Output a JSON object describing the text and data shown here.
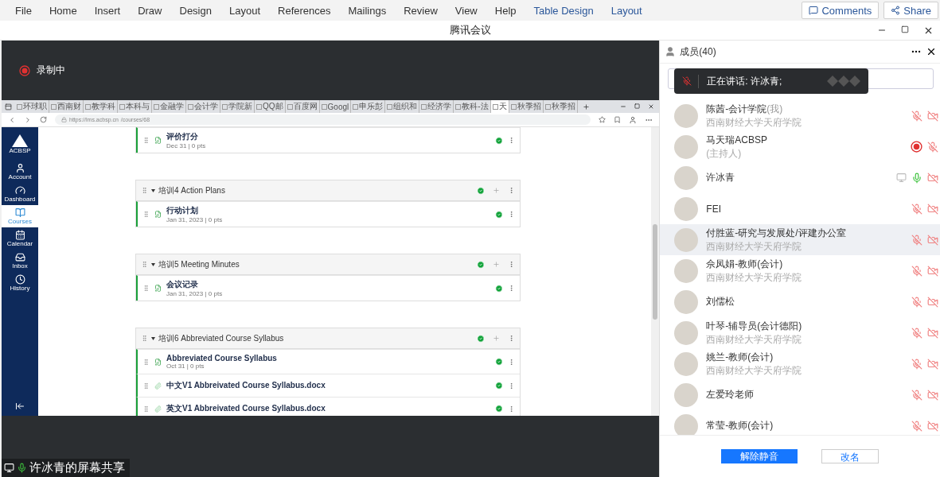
{
  "ribbon": {
    "menu": [
      {
        "label": "File",
        "kind": "standard"
      },
      {
        "label": "Home",
        "kind": "standard"
      },
      {
        "label": "Insert",
        "kind": "standard"
      },
      {
        "label": "Draw",
        "kind": "standard"
      },
      {
        "label": "Design",
        "kind": "standard"
      },
      {
        "label": "Layout",
        "kind": "standard"
      },
      {
        "label": "References",
        "kind": "standard"
      },
      {
        "label": "Mailings",
        "kind": "standard"
      },
      {
        "label": "Review",
        "kind": "standard"
      },
      {
        "label": "View",
        "kind": "standard"
      },
      {
        "label": "Help",
        "kind": "standard"
      },
      {
        "label": "Table Design",
        "kind": "contextual"
      },
      {
        "label": "Layout",
        "kind": "contextual"
      }
    ],
    "comments_button": "Comments",
    "share_button": "Share"
  },
  "window": {
    "title": "腾讯会议"
  },
  "stage": {
    "recording_label": "录制中",
    "caption": "许冰青的屏幕共享"
  },
  "browser": {
    "tabs": [
      {
        "label": "环球职",
        "selected": false
      },
      {
        "label": "西南财",
        "selected": false
      },
      {
        "label": "教学科",
        "selected": false
      },
      {
        "label": "本科与",
        "selected": false
      },
      {
        "label": "金融学",
        "selected": false
      },
      {
        "label": "会计学",
        "selected": false
      },
      {
        "label": "学院新",
        "selected": false
      },
      {
        "label": "QQ邮",
        "selected": false
      },
      {
        "label": "百度网",
        "selected": false
      },
      {
        "label": "Googl",
        "selected": false
      },
      {
        "label": "申乐彭",
        "selected": false
      },
      {
        "label": "组织和",
        "selected": false
      },
      {
        "label": "经济学",
        "selected": false
      },
      {
        "label": "教科-法",
        "selected": false
      },
      {
        "label": "天",
        "selected": true
      },
      {
        "label": "秋季招",
        "selected": false
      },
      {
        "label": "秋季招",
        "selected": false
      }
    ],
    "url_host": "https://lms.acbsp.cn",
    "url_path": "/courses/68"
  },
  "lms_nav": {
    "logo": "ACBSP",
    "items": [
      {
        "label": "Account",
        "selected": false
      },
      {
        "label": "Dashboard",
        "selected": false
      },
      {
        "label": "Courses",
        "selected": true
      },
      {
        "label": "Calendar",
        "selected": false
      },
      {
        "label": "Inbox",
        "selected": false
      },
      {
        "label": "History",
        "selected": false
      }
    ]
  },
  "leading_items": [
    {
      "kind": "assignment",
      "title": "评价打分",
      "meta": "Dec 31  |  0 pts"
    }
  ],
  "modules": [
    {
      "title": "培训4 Action Plans",
      "items": [
        {
          "kind": "assignment",
          "title": "行动计划",
          "meta": "Jan 31, 2023  |  0 pts"
        }
      ]
    },
    {
      "title": "培训5 Meeting Minutes",
      "items": [
        {
          "kind": "assignment",
          "title": "会议记录",
          "meta": "Jan 31, 2023  |  0 pts"
        }
      ]
    },
    {
      "title": "培训6 Abbreviated Course Syllabus",
      "items": [
        {
          "kind": "assignment",
          "title": "Abbreviated Course Syllabus",
          "meta": "Oct 31  |  0 pts"
        },
        {
          "kind": "attachment",
          "title": "中文V1 Abbreivated Course Syllabus.docx"
        },
        {
          "kind": "attachment",
          "title": "英文V1 Abbreivated Course Syllabus.docx"
        }
      ]
    }
  ],
  "members_panel": {
    "title": "成员(40)",
    "speaking_banner": "正在讲话: 许冰青;",
    "members": [
      {
        "name": "陈茜-会计学院",
        "tag": "(我)",
        "subtitle": "西南财经大学天府学院",
        "muted": true,
        "camera_off": true,
        "recording": false,
        "sharing": false,
        "selected": false
      },
      {
        "name": "马天瑞ACBSP",
        "subtitle": "(主持人)",
        "muted": true,
        "camera_off": false,
        "recording": true,
        "sharing": false,
        "selected": false
      },
      {
        "name": "许冰青",
        "muted": false,
        "camera_off": true,
        "recording": false,
        "sharing": true,
        "selected": false
      },
      {
        "name": "FEI",
        "muted": true,
        "camera_off": true,
        "recording": false,
        "sharing": false,
        "selected": false
      },
      {
        "name": "付胜蓝-研究与发展处/评建办公室",
        "subtitle": "西南财经大学天府学院",
        "muted": true,
        "camera_off": true,
        "recording": false,
        "sharing": false,
        "selected": true
      },
      {
        "name": "佘凤娟-教师(会计)",
        "subtitle": "西南财经大学天府学院",
        "muted": true,
        "camera_off": true,
        "recording": false,
        "sharing": false,
        "selected": false
      },
      {
        "name": "刘儒松",
        "muted": true,
        "camera_off": true,
        "recording": false,
        "sharing": false,
        "selected": false
      },
      {
        "name": "叶琴-辅导员(会计德阳)",
        "subtitle": "西南财经大学天府学院",
        "muted": true,
        "camera_off": true,
        "recording": false,
        "sharing": false,
        "selected": false
      },
      {
        "name": "姚兰-教师(会计)",
        "subtitle": "西南财经大学天府学院",
        "muted": true,
        "camera_off": true,
        "recording": false,
        "sharing": false,
        "selected": false
      },
      {
        "name": "左爱玲老师",
        "muted": true,
        "camera_off": true,
        "recording": false,
        "sharing": false,
        "selected": false
      },
      {
        "name": "常莹-教师(会计)",
        "muted": true,
        "camera_off": true,
        "recording": false,
        "sharing": false,
        "selected": false
      }
    ],
    "unmute_button": "解除静音",
    "rename_button": "改名"
  }
}
